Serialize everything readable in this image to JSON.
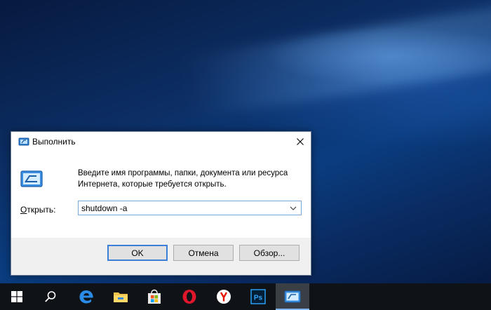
{
  "dialog": {
    "title": "Выполнить",
    "instruction": "Введите имя программы, папки, документа или ресурса Интернета, которые требуется открыть.",
    "open_label_accel": "О",
    "open_label_rest": "ткрыть:",
    "command_value": "shutdown -a",
    "buttons": {
      "ok": "OK",
      "cancel": "Отмена",
      "browse": "Обзор..."
    }
  },
  "taskbar": {
    "items": [
      {
        "icon": "windows-start-icon"
      },
      {
        "icon": "search-icon"
      },
      {
        "icon": "edge-browser-icon"
      },
      {
        "icon": "file-explorer-icon"
      },
      {
        "icon": "store-icon"
      },
      {
        "icon": "opera-browser-icon"
      },
      {
        "icon": "yandex-browser-icon"
      },
      {
        "icon": "photoshop-icon",
        "text": "Ps"
      },
      {
        "icon": "run-dialog-icon",
        "active": true
      }
    ]
  },
  "colors": {
    "accent_blue": "#3c7fd6",
    "taskbar": "#0f1217",
    "opera_red": "#e0162b",
    "yandex_red": "#e61400"
  }
}
